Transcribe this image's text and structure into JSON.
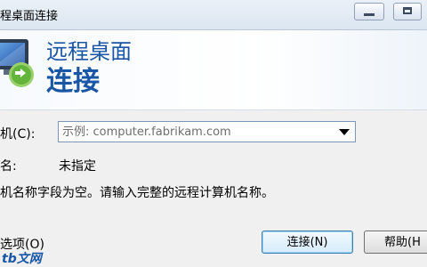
{
  "window": {
    "title": "程桌面连接",
    "minimize_icon": "minimize-icon",
    "maximize_icon": "maximize-icon"
  },
  "banner": {
    "line1": "远程桌面",
    "line2": "连接",
    "icon": "remote-desktop-monitor-icon"
  },
  "form": {
    "computer_label": "机(C):",
    "computer_placeholder": "示例: computer.fabrikam.com",
    "computer_value": "",
    "user_label": "名:",
    "user_value": "未指定",
    "message": "机名称字段为空。请输入完整的远程计算机名称。"
  },
  "footer": {
    "options_label": "选项(O)",
    "connect_label": "连接(N)",
    "help_label": "帮助(H",
    "watermark": "tb文网"
  }
}
